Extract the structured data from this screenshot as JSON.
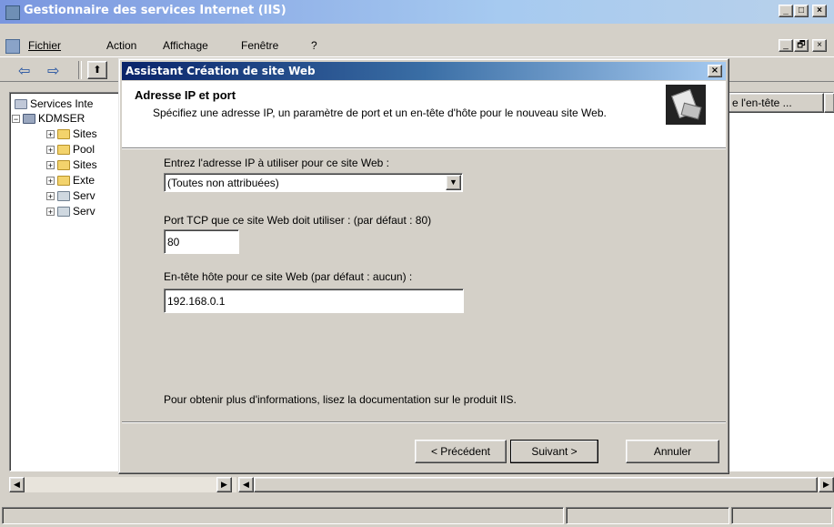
{
  "app": {
    "title": "Gestionnaire des services Internet (IIS)",
    "title_buttons": [
      "_",
      "□",
      "×"
    ],
    "child_buttons": [
      "_",
      "🗗",
      "×"
    ]
  },
  "menu": {
    "items": [
      "Fichier",
      "Action",
      "Affichage",
      "Fenêtre",
      "?"
    ]
  },
  "toolbar": {
    "back": "⇦",
    "forward": "⇨",
    "up": "⬆"
  },
  "tree": {
    "root": "Services Inte",
    "server": "KDMSER",
    "children": [
      "Sites",
      "Pool",
      "Sites",
      "Exte",
      "Serv",
      "Serv"
    ]
  },
  "list": {
    "column_partial": "e l'en-tête ..."
  },
  "dialog": {
    "title": "Assistant Création de site Web",
    "close": "×",
    "header_title": "Adresse IP et port",
    "header_desc": "Spécifiez une adresse IP, un paramètre de port et un en-tête d'hôte pour le nouveau site Web.",
    "ip_label": "Entrez l'adresse IP à utiliser pour ce site Web :",
    "ip_value": "(Toutes non attribuées)",
    "port_label": "Port TCP que ce site Web doit utiliser : (par défaut : 80)",
    "port_value": "80",
    "host_label": "En-tête hôte pour ce site Web (par défaut : aucun) :",
    "host_value": "192.168.0.1",
    "info_text": "Pour obtenir plus d'informations, lisez la documentation sur le produit IIS.",
    "btn_prev": "< Précédent",
    "btn_next": "Suivant >",
    "btn_cancel": "Annuler"
  }
}
